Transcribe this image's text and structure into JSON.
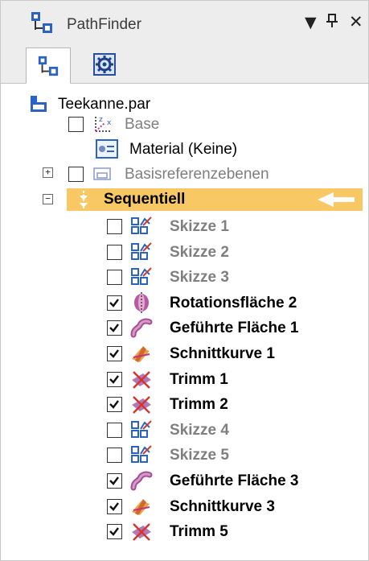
{
  "window": {
    "title": "PathFinder",
    "controls": {
      "dropdown": "▼",
      "pin": "📌",
      "close": "✕"
    }
  },
  "tabs": [
    {
      "icon": "pathfinder-tree-icon",
      "active": true
    },
    {
      "icon": "settings-gear-icon",
      "active": false
    }
  ],
  "tree": {
    "root": {
      "label": "Teekanne.par",
      "icon": "part-document-icon"
    },
    "items": [
      {
        "label": "Base",
        "style": "gray",
        "checked": false,
        "icon": "coordinate-system-icon"
      },
      {
        "label": "Material (Keine)",
        "style": "norm",
        "icon": "material-icon"
      },
      {
        "label": "Basisreferenzebenen",
        "style": "gray",
        "checked": false,
        "icon": "reference-planes-icon",
        "expander": "+"
      },
      {
        "label": "Sequentiell",
        "style": "bold",
        "icon": "sequential-icon",
        "expander": "−"
      },
      {
        "label": "Skizze 1",
        "style": "boldgray",
        "checked": false,
        "icon": "sketch-icon"
      },
      {
        "label": "Skizze 2",
        "style": "boldgray",
        "checked": false,
        "icon": "sketch-icon"
      },
      {
        "label": "Skizze 3",
        "style": "boldgray",
        "checked": false,
        "icon": "sketch-icon"
      },
      {
        "label": "Rotationsfläche 2",
        "style": "bold",
        "checked": true,
        "icon": "revolved-surface-icon"
      },
      {
        "label": "Geführte Fläche 1",
        "style": "bold",
        "checked": true,
        "icon": "swept-surface-icon"
      },
      {
        "label": "Schnittkurve 1",
        "style": "bold",
        "checked": true,
        "icon": "intersection-curve-icon"
      },
      {
        "label": "Trimm 1",
        "style": "bold",
        "checked": true,
        "icon": "trim-icon"
      },
      {
        "label": "Trimm 2",
        "style": "bold",
        "checked": true,
        "icon": "trim-icon"
      },
      {
        "label": "Skizze 4",
        "style": "boldgray",
        "checked": false,
        "icon": "sketch-icon"
      },
      {
        "label": "Skizze 5",
        "style": "boldgray",
        "checked": false,
        "icon": "sketch-icon"
      },
      {
        "label": "Geführte Fläche 3",
        "style": "bold",
        "checked": true,
        "icon": "swept-surface-icon"
      },
      {
        "label": "Schnittkurve 3",
        "style": "bold",
        "checked": true,
        "icon": "intersection-curve-icon"
      },
      {
        "label": "Trimm 5",
        "style": "bold",
        "checked": true,
        "icon": "trim-icon"
      }
    ]
  },
  "colors": {
    "sequential_highlight": "#f8c865",
    "gray_text": "#7f7f7f",
    "accent_blue": "#1f5fbf"
  }
}
